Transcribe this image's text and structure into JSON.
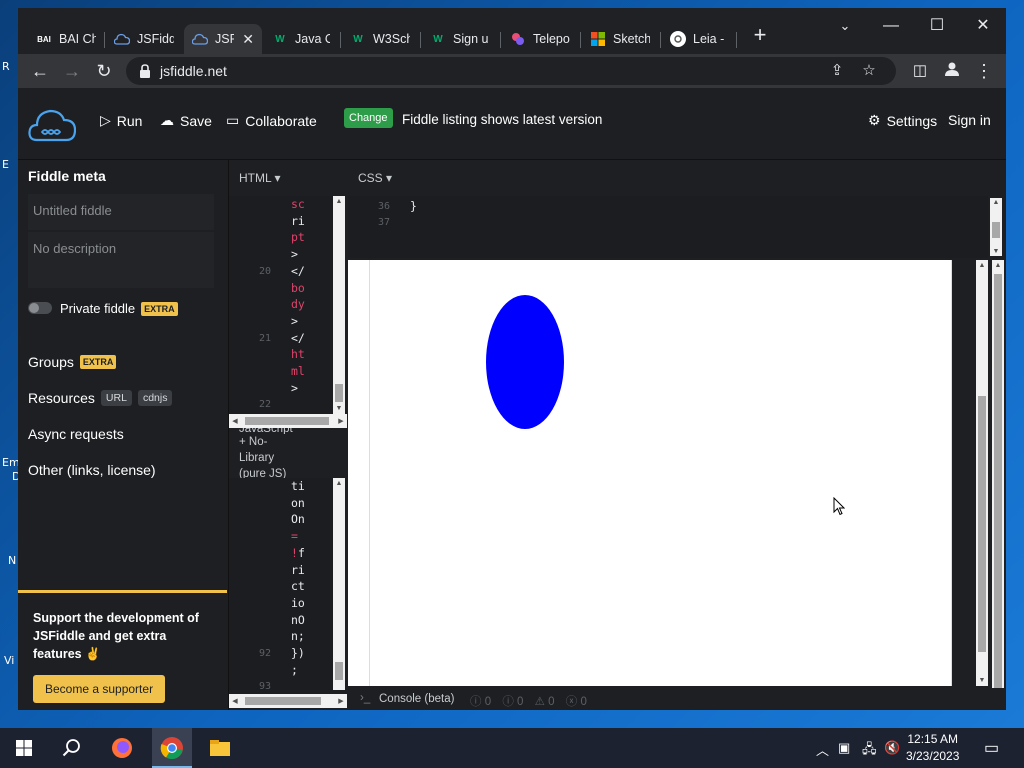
{
  "desktop": {
    "fragments": [
      "R",
      "E",
      "Em",
      "D",
      "N",
      "Vi"
    ]
  },
  "browser": {
    "tabs": [
      {
        "title": "BAI Ch",
        "icon": "bai-favicon",
        "active": false
      },
      {
        "title": "JSFiddl",
        "icon": "jsfiddle-cloud-icon",
        "active": false
      },
      {
        "title": "JSFi",
        "icon": "jsfiddle-cloud-icon",
        "active": true
      },
      {
        "title": "Java O",
        "icon": "w3schools-icon",
        "active": false
      },
      {
        "title": "W3Sch",
        "icon": "w3schools-icon",
        "active": false
      },
      {
        "title": "Sign u",
        "icon": "w3schools-icon",
        "active": false
      },
      {
        "title": "Telepo",
        "icon": "teleport-icon",
        "active": false
      },
      {
        "title": "Sketch",
        "icon": "microsoft-icon",
        "active": false
      },
      {
        "title": "Leia - ",
        "icon": "leia-icon",
        "active": false
      }
    ],
    "url": "jsfiddle.net"
  },
  "header": {
    "run": "Run",
    "save": "Save",
    "collaborate": "Collaborate",
    "change_badge": "Change",
    "listing_text": "Fiddle listing shows latest version",
    "settings": "Settings",
    "sign_in": "Sign in"
  },
  "sidebar": {
    "title": "Fiddle meta",
    "title_placeholder": "Untitled fiddle",
    "description_placeholder": "No description",
    "private_label": "Private fiddle",
    "extra_badge": "EXTRA",
    "groups": "Groups",
    "resources": "Resources",
    "url_badge": "URL",
    "cdnjs_badge": "cdnjs",
    "async": "Async requests",
    "other": "Other (links, license)",
    "support_text": "Support the development of JSFiddle and get extra features ✌",
    "support_button": "Become a supporter"
  },
  "html_panel": {
    "label": "HTML ▾",
    "lines": [
      {
        "num": "",
        "text": "sc"
      },
      {
        "num": "",
        "text": "ri"
      },
      {
        "num": "",
        "text": "pt"
      },
      {
        "num": "",
        "text": ">"
      },
      {
        "num": "20",
        "text": "</"
      },
      {
        "num": "",
        "text": "bo"
      },
      {
        "num": "",
        "text": "dy"
      },
      {
        "num": "",
        "text": ">"
      },
      {
        "num": "21",
        "text": "</"
      },
      {
        "num": "",
        "text": "ht"
      },
      {
        "num": "",
        "text": "ml"
      },
      {
        "num": "",
        "text": ">"
      },
      {
        "num": "22",
        "text": ""
      }
    ]
  },
  "js_panel": {
    "label_partial": "JavaScript",
    "label_lines": [
      "+ No-",
      "Library",
      "(pure JS)"
    ],
    "lines": [
      {
        "num": "",
        "text": "ti"
      },
      {
        "num": "",
        "text": "on"
      },
      {
        "num": "",
        "text": "On"
      },
      {
        "num": "",
        "text": "="
      },
      {
        "num": "",
        "text": "!f"
      },
      {
        "num": "",
        "text": "ri"
      },
      {
        "num": "",
        "text": "ct"
      },
      {
        "num": "",
        "text": "io"
      },
      {
        "num": "",
        "text": "nO"
      },
      {
        "num": "",
        "text": "n;"
      },
      {
        "num": "92",
        "text": "})"
      },
      {
        "num": "",
        "text": ";"
      },
      {
        "num": "93",
        "text": ""
      }
    ]
  },
  "css_panel": {
    "label": "CSS ▾",
    "lines": [
      {
        "num": "36",
        "text": "}"
      },
      {
        "num": "37",
        "text": ""
      }
    ]
  },
  "result": {
    "shape_color": "#0000ff"
  },
  "console": {
    "label": "Console (beta)",
    "counts": [
      "0",
      "0",
      "0",
      "0"
    ]
  },
  "taskbar": {
    "time": "12:15 AM",
    "date": "3/23/2023"
  },
  "colors": {
    "accent_yellow": "#f0c24b",
    "change_green": "#2e9d49",
    "code_red": "#e0436a",
    "ellipse_blue": "#0000ff"
  }
}
